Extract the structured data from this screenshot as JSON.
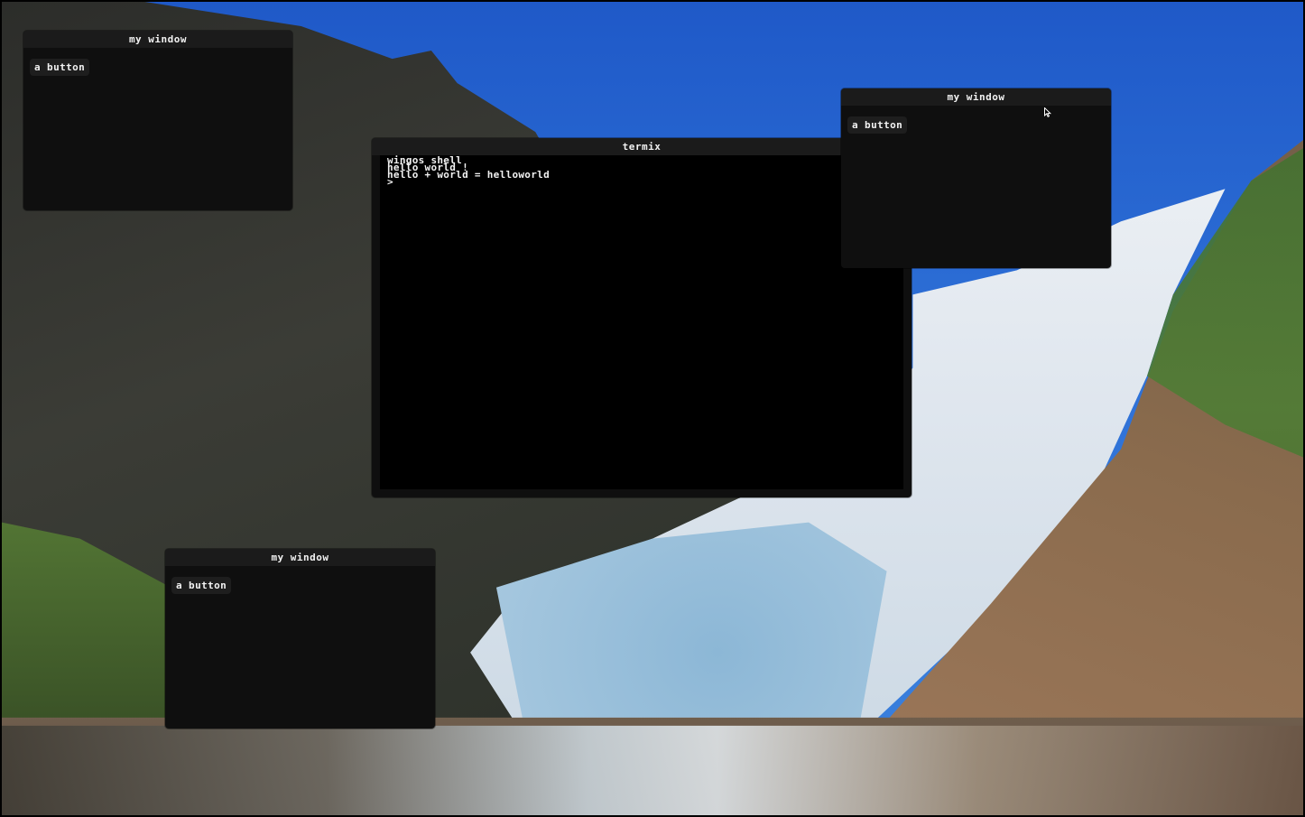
{
  "windows": [
    {
      "title": "my window",
      "button_label": "a button"
    },
    {
      "title": "my window",
      "button_label": "a button"
    },
    {
      "title": "my window",
      "button_label": "a button"
    }
  ],
  "terminal": {
    "title": "termix",
    "lines": [
      "wingos shell",
      "hello world !",
      "hello + world = helloworld",
      ">"
    ]
  },
  "cursor_icon": "arrow-pointer-icon"
}
